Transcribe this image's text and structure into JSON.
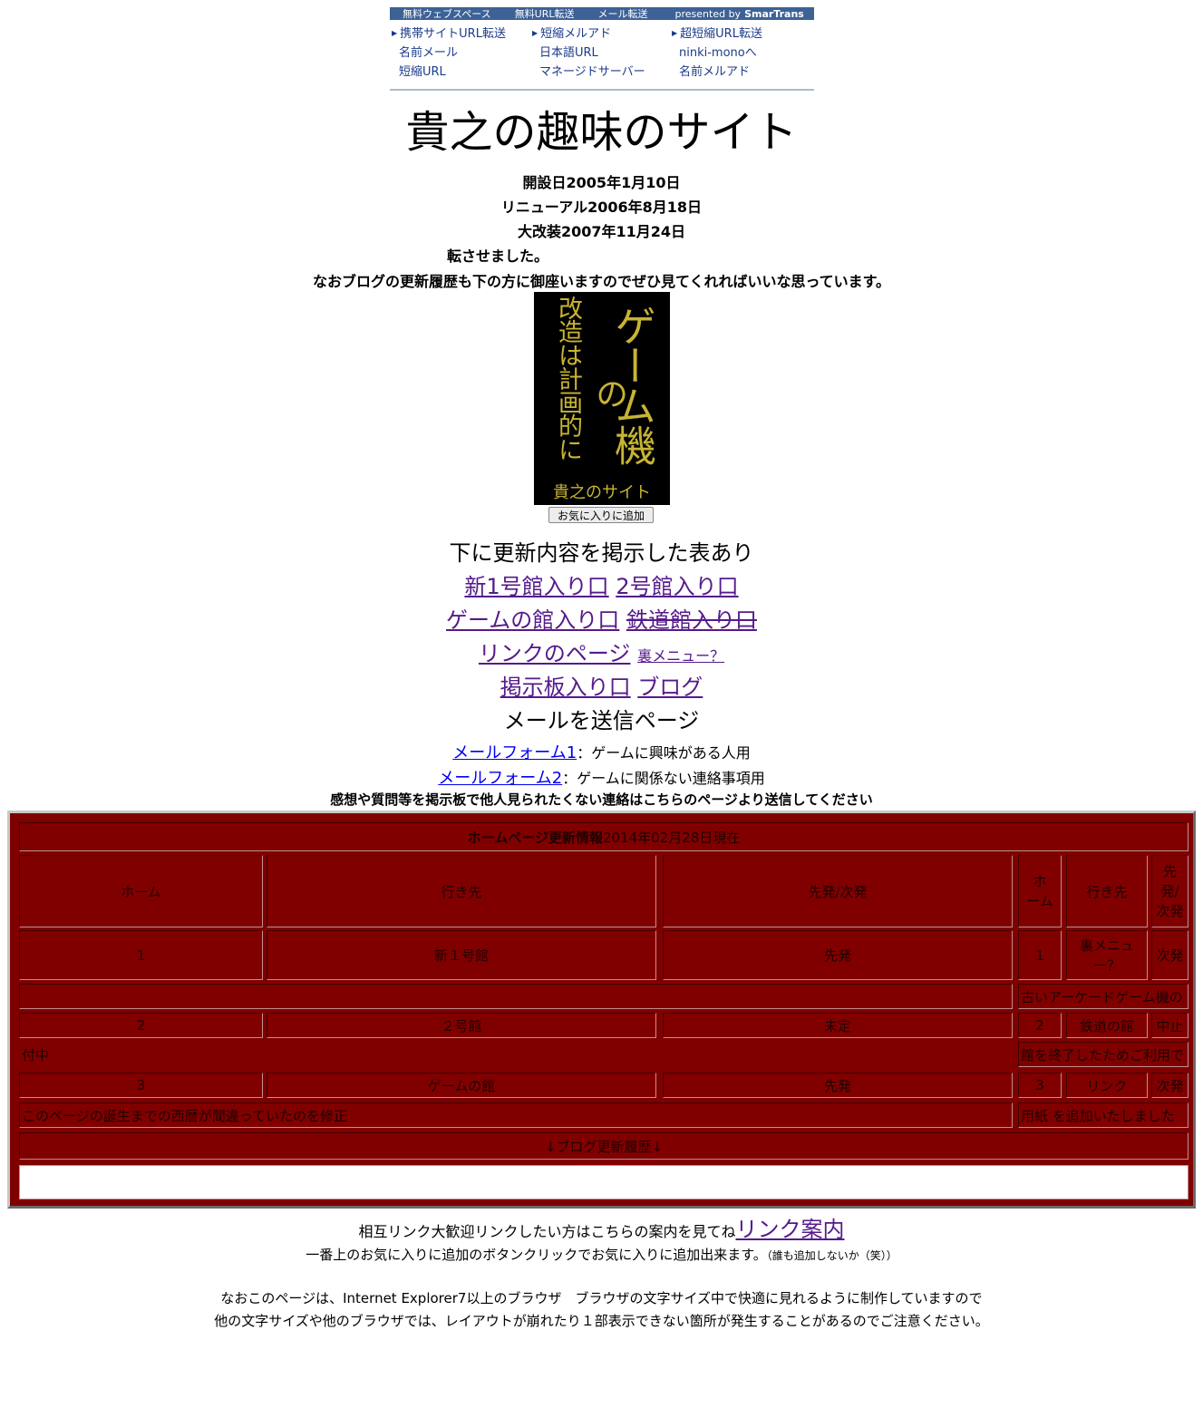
{
  "ad": {
    "bar": [
      "無料ウェブスペース",
      "無料URL転送",
      "メール転送"
    ],
    "presented_by": "presented by",
    "brand": "SmarTrans",
    "col1": [
      "携帯サイトURL転送",
      "名前メール",
      "短縮URL"
    ],
    "col2": [
      "短縮メルアド",
      "日本語URL",
      "マネージドサーバー"
    ],
    "col3": [
      "超短縮URL転送",
      "ninki-monoへ",
      "名前メルアド"
    ]
  },
  "site": {
    "title": "貴之の趣味のサイト",
    "opened": "開設日2005年1月10日",
    "renewal": "リニューアル2006年8月18日",
    "big_renewal": "大改装2007年11月24日",
    "marquee": "転させました。",
    "blog_note": "なおブログの更新履歴も下の方に御座いますのでぜひ見てくれればいいな思っています。"
  },
  "logo": {
    "main": "ゲーム機",
    "no": "の",
    "side": "改造は計画的に",
    "sub": "貴之のサイト"
  },
  "favorite_button": "お気に入りに追加",
  "nav": {
    "table_note": "下に更新内容を掲示した表あり",
    "new1": "新1号館入り口",
    "hall2": "2号館入り口",
    "game": "ゲームの館入り口",
    "railway": "鉄道館入り口",
    "links": "リンクのページ",
    "ura": "裏メニュー？",
    "bbs": "掲示板入り口",
    "blog": "ブログ",
    "mail_title": "メールを送信ページ",
    "form1": "メールフォーム1",
    "form1_desc": "：ゲームに興味がある人用",
    "form2": "メールフォーム2",
    "form2_desc": "：ゲームに関係ない連絡事項用",
    "private_note": "感想や質問等を掲示板で他人見られたくない連絡はこちらのページより送信してください"
  },
  "table": {
    "caption_bold": "ホームページ更新情報",
    "caption_date": "2014年02月28日現在",
    "headers": [
      "ホーム",
      "行き先",
      "先発/次発",
      "ホーム",
      "行き先",
      "先発/次発"
    ],
    "row1": [
      "1",
      "新１号館",
      "先発",
      "1",
      "裏メニュー？",
      "次発"
    ],
    "row1_info_right": "古いアーケードゲーム機の",
    "row2": [
      "2",
      "２号館",
      "未定",
      "2",
      "鉄道の館",
      "中止"
    ],
    "row2_info_left": "付中",
    "row2_info_right": "館を終了したためご利用で",
    "row3": [
      "3",
      "ゲームの館",
      "先発",
      "3",
      "リンク",
      "次発"
    ],
    "row3_info_left": "このページの誕生までの西暦が間違っていたのを修正",
    "row3_info_right": "用紙 を追加いたしました",
    "blog_history": "↓ブログ更新履歴↓"
  },
  "footer": {
    "mutual": "相互リンク大歓迎リンクしたい方はこちらの案内を見てね",
    "link_guide": "リンク案内",
    "fav_note": "一番上のお気に入りに追加のボタンクリックでお気に入りに追加出来ます。",
    "fav_small": "（誰も追加しないか（笑））",
    "browser1": "なおこのページは、Internet Explorer7以上のブラウザ　ブラウザの文字サイズ中で快適に見れるように制作していますので",
    "browser2": "他の文字サイズや他のブラウザでは、レイアウトが崩れたり１部表示できない箇所が発生することがあるのでご注意ください。"
  }
}
